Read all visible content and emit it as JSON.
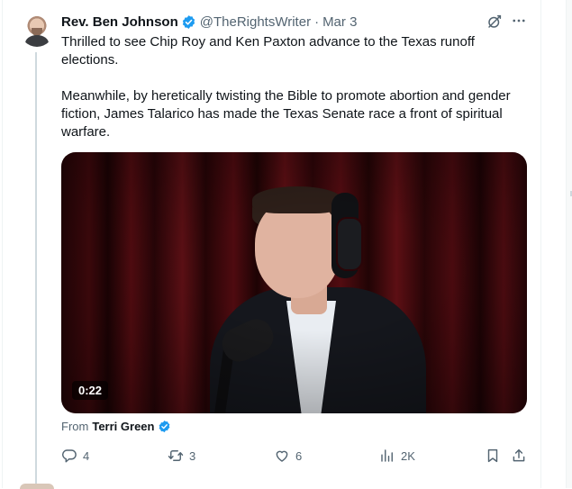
{
  "tweet": {
    "author_name": "Rev. Ben Johnson",
    "handle": "@TheRightsWriter",
    "separator": "·",
    "time": "Mar 3",
    "paragraphs": [
      "Thrilled to see Chip Roy and Ken Paxton advance to the Texas runoff elections.",
      "Meanwhile, by heretically twisting the Bible to promote abortion and gender fiction, James Talarico has made the Texas Senate race a front of spiritual warfare."
    ],
    "media": {
      "duration": "0:22"
    },
    "attribution": {
      "prefix": "From",
      "name": "Terri Green"
    },
    "actions": {
      "replies": "4",
      "reposts": "3",
      "likes": "6",
      "views": "2K"
    }
  },
  "colors": {
    "verified_blue": "#1d9bf0",
    "secondary_text": "#536471",
    "primary_text": "#0f1419",
    "thread_line": "#cfd9de"
  },
  "icons": [
    "verified-badge-icon",
    "grok-icon",
    "more-icon",
    "reply-icon",
    "retweet-icon",
    "like-icon",
    "views-icon",
    "bookmark-icon",
    "share-icon"
  ]
}
